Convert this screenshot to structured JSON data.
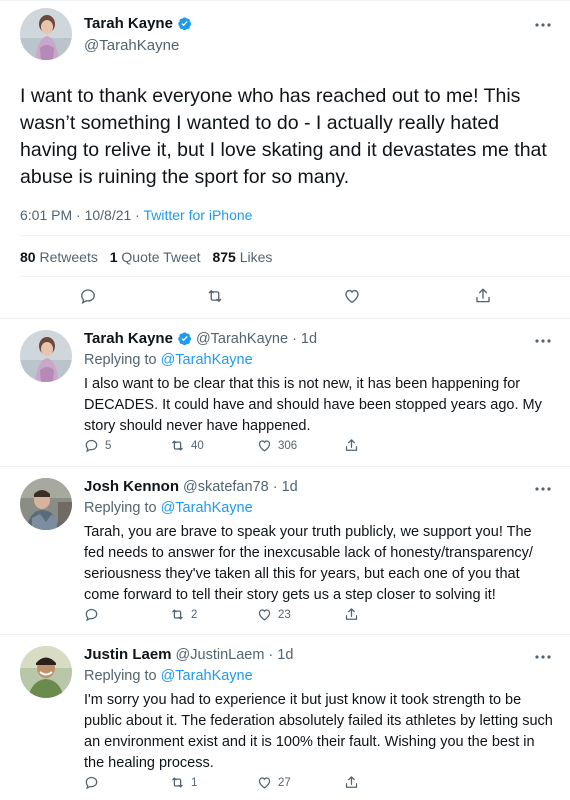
{
  "main_tweet": {
    "author_name": "Tarah Kayne",
    "handle": "@TarahKayne",
    "text": "I want to thank everyone who has reached out to me! This wasn’t something I wanted to do - I actually really hated having to relive it, but I love skating and it devastates me that abuse is ruining the sport for so many.",
    "timestamp": "6:01 PM · 10/8/21 · ",
    "source": "Twitter for iPhone",
    "retweets_count": "80",
    "retweets_label": "Retweets",
    "quote_count": "1",
    "quote_label": "Quote Tweet",
    "likes_count": "875",
    "likes_label": "Likes"
  },
  "replies": [
    {
      "author_name": "Tarah Kayne",
      "handle_time": "@TarahKayne · 1d",
      "replying_prefix": "Replying to ",
      "replying_to": "@TarahKayne",
      "text": "I also want to be clear that this is not new, it has been happening for DECADES. It could have and should have been stopped years ago. My story should never have happened.",
      "reply_count": "5",
      "retweet_count": "40",
      "like_count": "306"
    },
    {
      "author_name": "Josh Kennon",
      "handle_time": "@skatefan78 · 1d",
      "replying_prefix": "Replying to ",
      "replying_to": "@TarahKayne",
      "text": "Tarah, you are brave to speak your truth publicly, we support you! The fed needs to answer for the inexcusable lack of honesty/transparency/ seriousness they've taken all this for years, but each one of you that come forward to tell their story gets us a step closer to solving it!",
      "reply_count": "",
      "retweet_count": "2",
      "like_count": "23"
    },
    {
      "author_name": "Justin Laem",
      "handle_time": "@JustinLaem · 1d",
      "replying_prefix": "Replying to ",
      "replying_to": "@TarahKayne",
      "text": "I'm sorry you had to experience it but just know it took strength to be public about it. The federation absolutely failed its athletes by letting such an environment exist and it is 100% their fault. Wishing you the best in the healing process.",
      "reply_count": "",
      "retweet_count": "1",
      "like_count": "27"
    }
  ],
  "colors": {
    "accent": "#1d9bf0",
    "secondary_text": "#536471",
    "primary_text": "#0f1419",
    "divider": "#eff3f4"
  },
  "icons": [
    "verified-badge-icon",
    "more-dots-icon",
    "reply-icon",
    "retweet-icon",
    "like-icon",
    "share-icon"
  ]
}
